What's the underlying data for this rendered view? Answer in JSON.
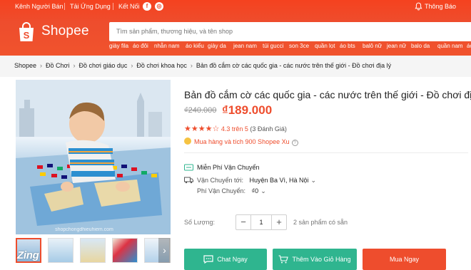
{
  "topbar": {
    "seller": "Kênh Người Bán",
    "app": "Tải Ứng Dụng",
    "connect": "Kết Nối",
    "notifications": "Thông Báo"
  },
  "logo": {
    "text": "Shopee"
  },
  "search": {
    "placeholder": "Tìm sản phẩm, thương hiệu, và tên shop"
  },
  "tags": [
    "giày fila",
    "áo đôi",
    "nhẫn nam",
    "áo kiểu",
    "giày da",
    "jean nam",
    "túi gucci",
    "son 3ce",
    "quần lọt",
    "áo bts",
    "balô nữ",
    "jean nữ",
    "balo da",
    "quần nam",
    "áo"
  ],
  "breadcrumb": [
    "Shopee",
    "Đồ Chơi",
    "Đồ chơi giáo dục",
    "Đồ chơi khoa học",
    "Bản đồ cắm cờ các quốc gia - các nước trên thế giới - Đồ chơi địa lý"
  ],
  "product": {
    "title": "Bản đồ cắm cờ các quốc gia - các nước trên thế giới - Đồ chơi địa lý",
    "old_price": "₫240.000",
    "price": "₫189.000",
    "rating_value": "4.3 trên 5",
    "rating_count": "(3 Đánh Giá)",
    "rating_stars": 4.3,
    "coins": "Mua hàng và tích 900 Shopee Xu",
    "image_watermark": "shopchongdhieuhiem.com"
  },
  "shipping": {
    "free": "Miễn Phí Vận Chuyển",
    "to_label": "Vận Chuyển tới:",
    "to_value": "Huyện Ba Vì, Hà Nội",
    "fee_label": "Phí Vận Chuyển:",
    "fee_value": "₫0"
  },
  "quantity": {
    "label": "Số Lượng:",
    "minus": "−",
    "value": "1",
    "plus": "+",
    "available": "2 sản phẩm có sẵn"
  },
  "buttons": {
    "chat": "Chat Ngay",
    "add_cart": "Thêm Vào Giỏ Hàng",
    "buy": "Mua Ngay"
  },
  "watermark": "Zing",
  "colors": {
    "accent": "#ee4d2d",
    "chat_button": "#2fb58f",
    "cart_button": "#2fb58f",
    "buy_button": "#ee4d2d"
  }
}
